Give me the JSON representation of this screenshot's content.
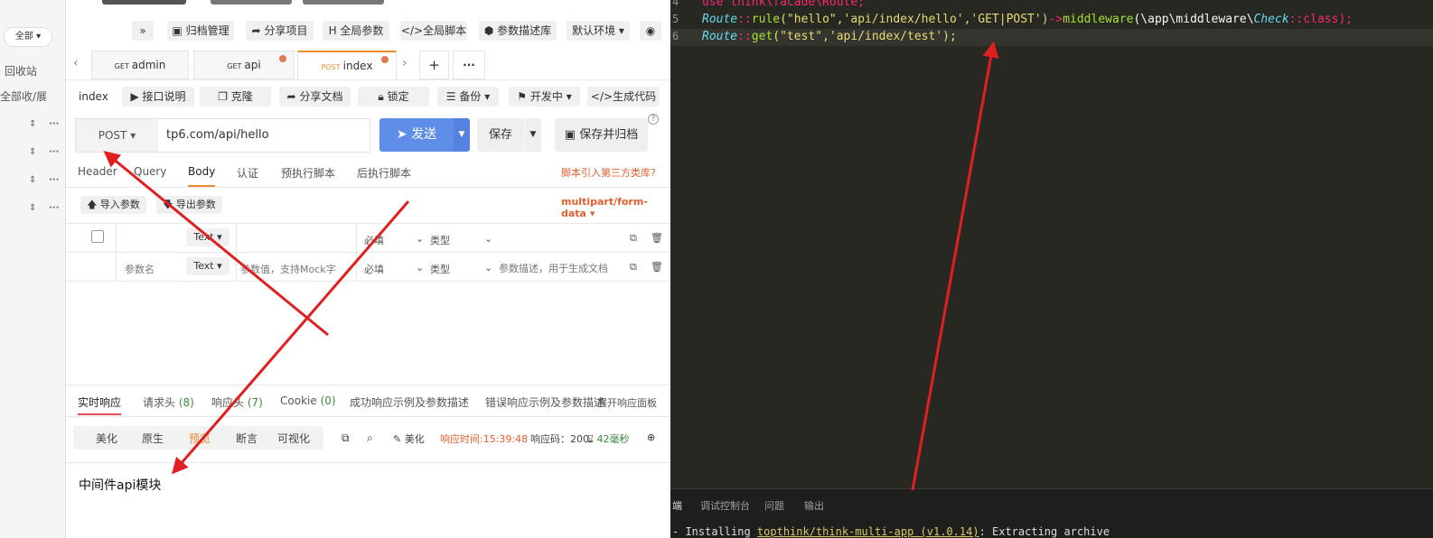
{
  "sidebar": {
    "scope_dropdown": "全部 ▾",
    "recycle": "回收站",
    "collapse_all": "全部收/展",
    "row_controls": [
      "⇕",
      "⇕",
      "⇕",
      "⇕"
    ],
    "row_more": [
      "···",
      "···",
      "···",
      "···"
    ]
  },
  "toolbar": {
    "expand": "»",
    "archive_mgmt": "归档管理",
    "share_project": "分享项目",
    "global_params": "全局参数",
    "global_script": "全局脚本",
    "param_desc_lib": "参数描述库",
    "env": "默认环境",
    "eye": "◉"
  },
  "tabs": [
    {
      "method": "GET",
      "label": "admin"
    },
    {
      "method": "GET",
      "label": "api"
    },
    {
      "method": "POST",
      "label": "index"
    }
  ],
  "tab_controls": {
    "prev": "‹",
    "next": "›",
    "add": "+",
    "more": "···"
  },
  "subbar": {
    "name": "index",
    "api_desc": "接口说明",
    "clone": "克隆",
    "share_doc": "分享文档",
    "lock": "锁定",
    "backup": "备份",
    "dev_status": "开发中",
    "gen_code": "生成代码"
  },
  "request": {
    "method": "POST",
    "url": "tp6.com/api/hello",
    "send": "发送",
    "save": "保存",
    "save_archive": "保存并归档",
    "help": "?"
  },
  "param_tabs": [
    "Header",
    "Query",
    "Body",
    "认证",
    "预执行脚本",
    "后执行脚本"
  ],
  "third_party": "脚本引入第三方类库?",
  "body": {
    "import": "导入参数",
    "export": "导出参数",
    "content_type": "multipart/form-data"
  },
  "table": {
    "header_row": {
      "type": "Text",
      "required": "必填",
      "kind": "类型"
    },
    "row": {
      "name_placeholder": "参数名",
      "type": "Text",
      "value_placeholder": "参数值，支持Mock字",
      "required": "必填",
      "kind": "类型",
      "desc_placeholder": "参数描述，用于生成文档"
    }
  },
  "response_tabs": [
    {
      "label": "实时响应",
      "count": ""
    },
    {
      "label": "请求头",
      "count": "(8)"
    },
    {
      "label": "响应头",
      "count": "(7)"
    },
    {
      "label": "Cookie",
      "count": "(0)"
    },
    {
      "label": "成功响应示例及参数描述",
      "count": ""
    },
    {
      "label": "错误响应示例及参数描述",
      "count": ""
    }
  ],
  "expand_panel": "展开响应面板",
  "format_tabs": [
    "美化",
    "原生",
    "预览",
    "断言",
    "可视化"
  ],
  "status": {
    "beautify": "美化",
    "hint": "响应时间:15:39:48 实际",
    "code": "响应码：200",
    "time": "42毫秒"
  },
  "response_body": "中间件api模块",
  "editor": {
    "line_numbers": [
      "4",
      "5",
      "6"
    ],
    "line4": "use think\\facade\\Route;",
    "line5": {
      "cls": "Route",
      "sep": "::",
      "fn": "rule",
      "args": "(\"hello\",'api/index/hello','GET|POST')",
      "arrow": "->",
      "fn2": "middleware",
      "ns": "(\\app\\middleware\\",
      "cls2": "Check",
      "tail": "::class);"
    },
    "line6": {
      "cls": "Route",
      "sep": "::",
      "fn": "get",
      "args": "(\"test\",'api/index/test');"
    },
    "panel_tabs": [
      "端",
      "调试控制台",
      "问题",
      "输出"
    ],
    "terminal": {
      "prefix": "- Installing ",
      "pkg": "topthink/think-multi-app (v1.0.14)",
      "suffix": ": Extracting archive"
    }
  },
  "colors": {
    "accent": "#f28a30",
    "send": "#5f8ee8",
    "annotation": "#e02020"
  }
}
